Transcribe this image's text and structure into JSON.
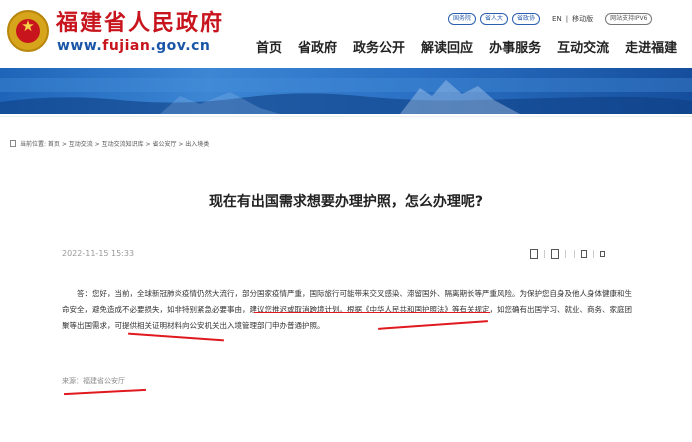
{
  "header": {
    "site_name": "福建省人民政府",
    "url_prefix": "www.",
    "url_mid": "fujian",
    "url_suffix": ".gov.cn",
    "top_links": [
      "国务院",
      "省人大",
      "省政协"
    ],
    "lang": "EN",
    "divider": "|",
    "mobile": "移动版",
    "ipv6": "网站支持IPV6"
  },
  "nav": [
    "首页",
    "省政府",
    "政务公开",
    "解读回应",
    "办事服务",
    "互动交流",
    "走进福建"
  ],
  "breadcrumb": "当前位置: 首页 > 互动交流 > 互动交流知识库 > 省公安厅 > 出入境类",
  "article": {
    "title": "现在有出国需求想要办理护照，怎么办理呢?",
    "date": "2022-11-15 15:33",
    "body_part1": "答：您好，当前，全球新冠肺炎疫情仍然大流行，部分国家疫情严重，国际旅行可能带来交叉感染、滞留国外、隔离期长等严重风险。为保护您自身及他人身体健康和生命安全，避免造成不必要损失，",
    "body_part2": "如非特别紧急必要事由，建议您推迟或取消跨境计划",
    "body_part3": "。根据《中华人民共和国护照法》等有关规定，如您确有出国学习、就业、商务、家庭团聚等出国需求，可提供相关证明材料向公安机关出入境管理部门申办普通护照。",
    "source": "来源：福建省公安厅"
  },
  "colors": {
    "brand_red": "#c8151d",
    "brand_blue": "#1a56a8",
    "annotation_red": "#e0191e"
  }
}
